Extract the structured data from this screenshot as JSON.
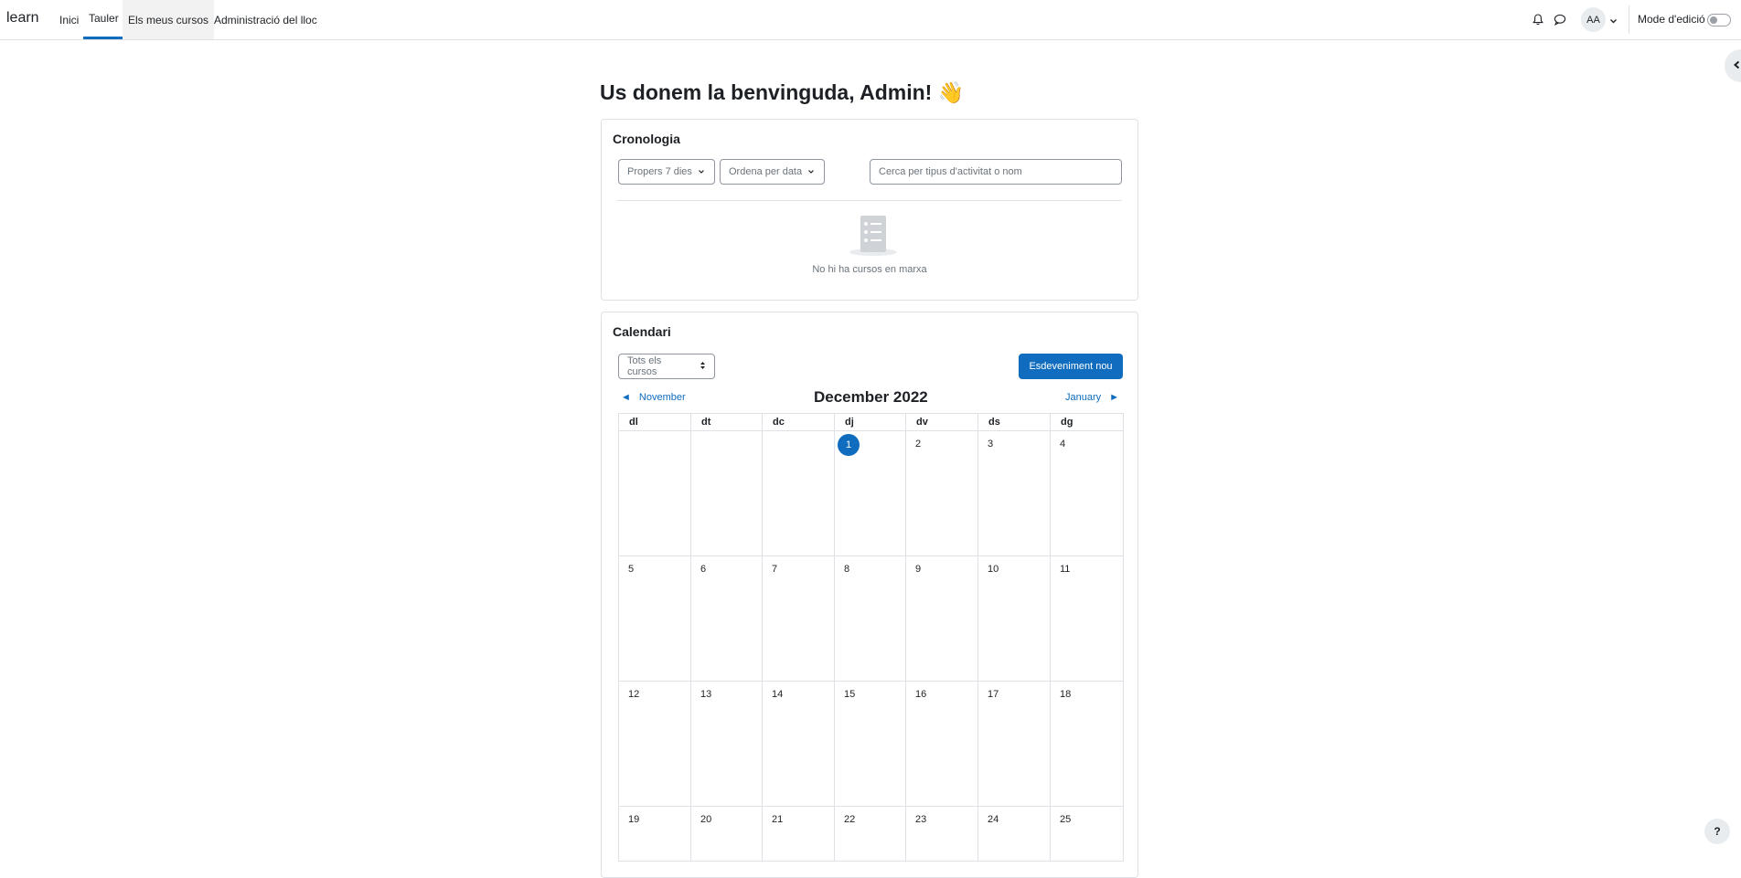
{
  "navbar": {
    "brand": "learn",
    "items": [
      {
        "label": "Inici"
      },
      {
        "label": "Tauler"
      },
      {
        "label": "Els meus cursos"
      },
      {
        "label": "Administració del lloc"
      }
    ],
    "notifications_icon": "bell-icon",
    "messages_icon": "chat-bubble-icon",
    "avatar_initials": "AA",
    "edit_mode_label": "Mode d'edició",
    "edit_mode_on": false
  },
  "page": {
    "title": "Us donem la benvinguda, Admin! 👋"
  },
  "timeline": {
    "title": "Cronologia",
    "filter_label": "Propers 7 dies",
    "sort_label": "Ordena per data",
    "search_placeholder": "Cerca per tipus d'activitat o nom",
    "empty_message": "No hi ha cursos en marxa"
  },
  "calendar": {
    "title": "Calendari",
    "course_filter": "Tots els cursos",
    "new_event_label": "Esdeveniment nou",
    "prev_month": "November",
    "next_month": "January",
    "current_month": "December 2022",
    "prev_arrow": "◄",
    "next_arrow": "►",
    "weekdays": [
      "dl",
      "dt",
      "dc",
      "dj",
      "dv",
      "ds",
      "dg"
    ],
    "weeks": [
      [
        "",
        "",
        "",
        "1",
        "2",
        "3",
        "4"
      ],
      [
        "5",
        "6",
        "7",
        "8",
        "9",
        "10",
        "11"
      ],
      [
        "12",
        "13",
        "14",
        "15",
        "16",
        "17",
        "18"
      ],
      [
        "19",
        "20",
        "21",
        "22",
        "23",
        "24",
        "25"
      ]
    ],
    "today": "1"
  },
  "help": {
    "label": "?"
  },
  "colors": {
    "primary": "#0f6cbf",
    "border": "#dee2e6",
    "muted": "#6a737b"
  }
}
